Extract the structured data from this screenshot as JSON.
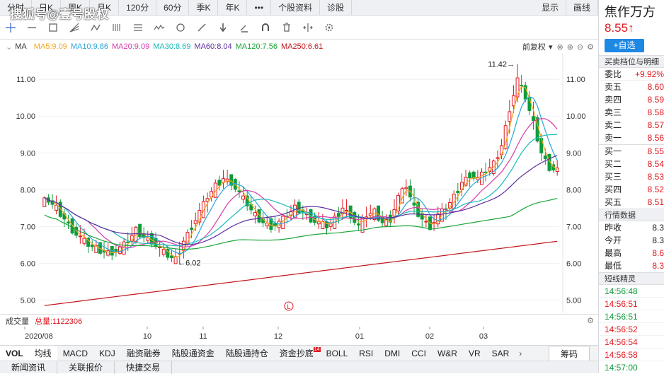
{
  "watermark": "搜狐号@壹号股权",
  "period_tabs": [
    "分时",
    "日K",
    "周K",
    "月K",
    "120分",
    "60分",
    "季K",
    "年K",
    "•••",
    "个股资料",
    "诊股",
    "显示",
    "画线"
  ],
  "ma_bar": {
    "label": "MA",
    "restore": "前复权",
    "items": [
      {
        "text": "MA5:9.09",
        "color": "#f5a623"
      },
      {
        "text": "MA10:9.86",
        "color": "#2aa5d8"
      },
      {
        "text": "MA20:9.09",
        "color": "#d63aa8"
      },
      {
        "text": "MA30:8.69",
        "color": "#19b9b9"
      },
      {
        "text": "MA60:8.04",
        "color": "#5c2f9e"
      },
      {
        "text": "MA120:7.56",
        "color": "#1aa538"
      },
      {
        "text": "MA250:6.61",
        "color": "#c0141a"
      }
    ]
  },
  "y_axis": {
    "labels": [
      "11.00",
      "10.00",
      "9.00",
      "8.00",
      "7.00",
      "6.00",
      "5.00"
    ]
  },
  "annotations": {
    "high": "11.42→",
    "low": "←6.02",
    "l_mark": "L"
  },
  "volume": {
    "label": "成交量",
    "total": "总量:1122306"
  },
  "x_axis": {
    "labels": [
      "2020/08",
      "10",
      "11",
      "12",
      "01",
      "02",
      "03"
    ]
  },
  "indicators": [
    "VOL",
    "均线",
    "MACD",
    "KDJ",
    "融资融券",
    "陆股通资金",
    "陆股通持仓",
    "资金抄底",
    "BOLL",
    "RSI",
    "DMI",
    "CCI",
    "W&R",
    "VR",
    "SAR"
  ],
  "indicator_badge": "14",
  "chip_label": "筹码",
  "bottom_tabs": [
    "新闻资讯",
    "关联报价",
    "快捷交易"
  ],
  "stock": {
    "name": "焦作万方",
    "price": "8.55",
    "arrow": "↑",
    "add_button": "+自选",
    "orderbook_title": "买卖档位与明细"
  },
  "commission": {
    "label": "委比",
    "value": "+9.92%"
  },
  "asks": [
    {
      "label": "卖五",
      "price": "8.60"
    },
    {
      "label": "卖四",
      "price": "8.59"
    },
    {
      "label": "卖三",
      "price": "8.58"
    },
    {
      "label": "卖二",
      "price": "8.57"
    },
    {
      "label": "卖一",
      "price": "8.56"
    }
  ],
  "bids": [
    {
      "label": "买一",
      "price": "8.55"
    },
    {
      "label": "买二",
      "price": "8.54"
    },
    {
      "label": "买三",
      "price": "8.53"
    },
    {
      "label": "买四",
      "price": "8.52"
    },
    {
      "label": "买五",
      "price": "8.51"
    }
  ],
  "quote_title": "行情数据",
  "quotes": [
    {
      "label": "昨收",
      "value": "8.3"
    },
    {
      "label": "今开",
      "value": "8.3"
    },
    {
      "label": "最高",
      "value": "8.6"
    },
    {
      "label": "最低",
      "value": "8.3"
    }
  ],
  "ticks_title": "短线精灵",
  "ticks": [
    {
      "time": "14:56:48",
      "cls": "dn"
    },
    {
      "time": "14:56:51",
      "cls": "up"
    },
    {
      "time": "14:56:51",
      "cls": "dn"
    },
    {
      "time": "14:56:52",
      "cls": "up"
    },
    {
      "time": "14:56:54",
      "cls": "up"
    },
    {
      "time": "14:56:58",
      "cls": "up"
    },
    {
      "time": "14:57:00",
      "cls": "dn"
    }
  ],
  "colors": {
    "up": "#e0181f",
    "down": "#109b3a",
    "accent": "#1e88e5"
  },
  "chart_data": {
    "type": "candlestick",
    "ylim": [
      4.7,
      11.6
    ],
    "y_ticks": [
      5,
      6,
      7,
      8,
      9,
      10,
      11
    ],
    "x": [
      "2020/08",
      "10",
      "11",
      "12",
      "01",
      "02",
      "03"
    ],
    "close_approx": [
      7.7,
      7.5,
      7.2,
      6.9,
      6.7,
      6.5,
      6.4,
      6.3,
      6.3,
      6.4,
      6.6,
      6.9,
      6.7,
      6.6,
      6.4,
      6.2,
      6.1,
      6.6,
      7.0,
      7.4,
      7.8,
      8.1,
      8.3,
      8.2,
      7.9,
      7.6,
      7.3,
      7.1,
      7.0,
      7.1,
      7.3,
      7.5,
      7.4,
      7.2,
      7.1,
      7.0,
      7.2,
      7.5,
      7.3,
      7.0,
      7.3,
      7.4,
      7.1,
      7.2,
      7.8,
      8.1,
      7.5,
      7.2,
      7.0,
      7.3,
      7.5,
      7.8,
      8.2,
      8.4,
      8.3,
      8.5,
      8.7,
      9.2,
      10.2,
      11.0,
      10.5,
      9.8,
      9.0,
      8.6,
      8.55
    ],
    "high": 11.42,
    "low": 6.02,
    "ma": [
      {
        "name": "MA5",
        "value": 9.09
      },
      {
        "name": "MA10",
        "value": 9.86
      },
      {
        "name": "MA20",
        "value": 9.09
      },
      {
        "name": "MA30",
        "value": 8.69
      },
      {
        "name": "MA60",
        "value": 8.04
      },
      {
        "name": "MA120",
        "value": 7.56
      },
      {
        "name": "MA250",
        "value": 6.61
      }
    ]
  }
}
